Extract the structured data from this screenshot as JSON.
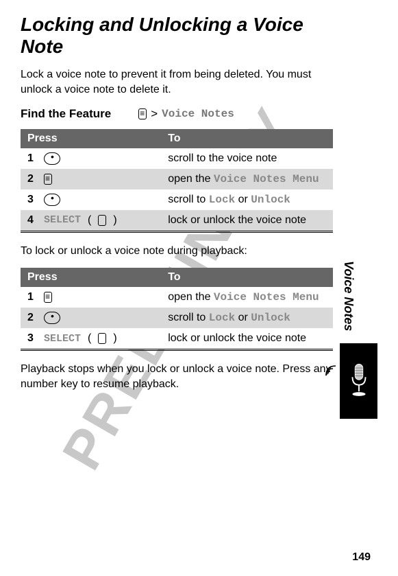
{
  "title": "Locking and Unlocking a Voice Note",
  "intro": "Lock a voice note to prevent it from being deleted. You must unlock a voice note to delete it.",
  "feature": {
    "label": "Find the Feature",
    "gt": ">",
    "path": "Voice Notes"
  },
  "table_headers": {
    "press": "Press",
    "to": "To"
  },
  "table1": [
    {
      "n": "1",
      "press_type": "nav",
      "to_pre": "scroll to the voice note",
      "to_mono": "",
      "to_post": ""
    },
    {
      "n": "2",
      "press_type": "menu",
      "to_pre": "open the ",
      "to_mono": "Voice Notes Menu",
      "to_post": ""
    },
    {
      "n": "3",
      "press_type": "nav",
      "to_pre": "scroll to ",
      "to_mono": "Lock",
      "to_mid": " or ",
      "to_mono2": "Unlock",
      "to_post": ""
    },
    {
      "n": "4",
      "press_type": "select",
      "press_label": "SELECT",
      "to_pre": "lock or unlock the voice note",
      "to_mono": "",
      "to_post": ""
    }
  ],
  "between_text": "To lock or unlock a voice note during playback:",
  "table2": [
    {
      "n": "1",
      "press_type": "menu",
      "to_pre": "open the ",
      "to_mono": "Voice Notes Menu",
      "to_post": ""
    },
    {
      "n": "2",
      "press_type": "nav",
      "to_pre": "scroll to ",
      "to_mono": "Lock",
      "to_mid": " or ",
      "to_mono2": "Unlock",
      "to_post": ""
    },
    {
      "n": "3",
      "press_type": "select",
      "press_label": "SELECT",
      "to_pre": "lock or unlock the voice note",
      "to_mono": "",
      "to_post": ""
    }
  ],
  "after_text": "Playback stops when you lock or unlock a voice note. Press any number key to resume playback.",
  "side_tab": "Voice Notes",
  "page_number": "149",
  "watermark": "PRELIMINARY"
}
